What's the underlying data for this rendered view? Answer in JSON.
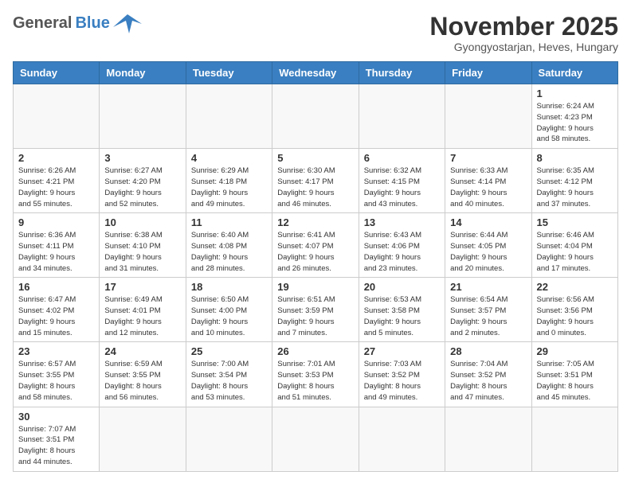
{
  "header": {
    "logo_general": "General",
    "logo_blue": "Blue",
    "month_title": "November 2025",
    "location": "Gyongyostarjan, Heves, Hungary"
  },
  "weekdays": [
    "Sunday",
    "Monday",
    "Tuesday",
    "Wednesday",
    "Thursday",
    "Friday",
    "Saturday"
  ],
  "weeks": [
    [
      {
        "day": "",
        "info": ""
      },
      {
        "day": "",
        "info": ""
      },
      {
        "day": "",
        "info": ""
      },
      {
        "day": "",
        "info": ""
      },
      {
        "day": "",
        "info": ""
      },
      {
        "day": "",
        "info": ""
      },
      {
        "day": "1",
        "info": "Sunrise: 6:24 AM\nSunset: 4:23 PM\nDaylight: 9 hours\nand 58 minutes."
      }
    ],
    [
      {
        "day": "2",
        "info": "Sunrise: 6:26 AM\nSunset: 4:21 PM\nDaylight: 9 hours\nand 55 minutes."
      },
      {
        "day": "3",
        "info": "Sunrise: 6:27 AM\nSunset: 4:20 PM\nDaylight: 9 hours\nand 52 minutes."
      },
      {
        "day": "4",
        "info": "Sunrise: 6:29 AM\nSunset: 4:18 PM\nDaylight: 9 hours\nand 49 minutes."
      },
      {
        "day": "5",
        "info": "Sunrise: 6:30 AM\nSunset: 4:17 PM\nDaylight: 9 hours\nand 46 minutes."
      },
      {
        "day": "6",
        "info": "Sunrise: 6:32 AM\nSunset: 4:15 PM\nDaylight: 9 hours\nand 43 minutes."
      },
      {
        "day": "7",
        "info": "Sunrise: 6:33 AM\nSunset: 4:14 PM\nDaylight: 9 hours\nand 40 minutes."
      },
      {
        "day": "8",
        "info": "Sunrise: 6:35 AM\nSunset: 4:12 PM\nDaylight: 9 hours\nand 37 minutes."
      }
    ],
    [
      {
        "day": "9",
        "info": "Sunrise: 6:36 AM\nSunset: 4:11 PM\nDaylight: 9 hours\nand 34 minutes."
      },
      {
        "day": "10",
        "info": "Sunrise: 6:38 AM\nSunset: 4:10 PM\nDaylight: 9 hours\nand 31 minutes."
      },
      {
        "day": "11",
        "info": "Sunrise: 6:40 AM\nSunset: 4:08 PM\nDaylight: 9 hours\nand 28 minutes."
      },
      {
        "day": "12",
        "info": "Sunrise: 6:41 AM\nSunset: 4:07 PM\nDaylight: 9 hours\nand 26 minutes."
      },
      {
        "day": "13",
        "info": "Sunrise: 6:43 AM\nSunset: 4:06 PM\nDaylight: 9 hours\nand 23 minutes."
      },
      {
        "day": "14",
        "info": "Sunrise: 6:44 AM\nSunset: 4:05 PM\nDaylight: 9 hours\nand 20 minutes."
      },
      {
        "day": "15",
        "info": "Sunrise: 6:46 AM\nSunset: 4:04 PM\nDaylight: 9 hours\nand 17 minutes."
      }
    ],
    [
      {
        "day": "16",
        "info": "Sunrise: 6:47 AM\nSunset: 4:02 PM\nDaylight: 9 hours\nand 15 minutes."
      },
      {
        "day": "17",
        "info": "Sunrise: 6:49 AM\nSunset: 4:01 PM\nDaylight: 9 hours\nand 12 minutes."
      },
      {
        "day": "18",
        "info": "Sunrise: 6:50 AM\nSunset: 4:00 PM\nDaylight: 9 hours\nand 10 minutes."
      },
      {
        "day": "19",
        "info": "Sunrise: 6:51 AM\nSunset: 3:59 PM\nDaylight: 9 hours\nand 7 minutes."
      },
      {
        "day": "20",
        "info": "Sunrise: 6:53 AM\nSunset: 3:58 PM\nDaylight: 9 hours\nand 5 minutes."
      },
      {
        "day": "21",
        "info": "Sunrise: 6:54 AM\nSunset: 3:57 PM\nDaylight: 9 hours\nand 2 minutes."
      },
      {
        "day": "22",
        "info": "Sunrise: 6:56 AM\nSunset: 3:56 PM\nDaylight: 9 hours\nand 0 minutes."
      }
    ],
    [
      {
        "day": "23",
        "info": "Sunrise: 6:57 AM\nSunset: 3:55 PM\nDaylight: 8 hours\nand 58 minutes."
      },
      {
        "day": "24",
        "info": "Sunrise: 6:59 AM\nSunset: 3:55 PM\nDaylight: 8 hours\nand 56 minutes."
      },
      {
        "day": "25",
        "info": "Sunrise: 7:00 AM\nSunset: 3:54 PM\nDaylight: 8 hours\nand 53 minutes."
      },
      {
        "day": "26",
        "info": "Sunrise: 7:01 AM\nSunset: 3:53 PM\nDaylight: 8 hours\nand 51 minutes."
      },
      {
        "day": "27",
        "info": "Sunrise: 7:03 AM\nSunset: 3:52 PM\nDaylight: 8 hours\nand 49 minutes."
      },
      {
        "day": "28",
        "info": "Sunrise: 7:04 AM\nSunset: 3:52 PM\nDaylight: 8 hours\nand 47 minutes."
      },
      {
        "day": "29",
        "info": "Sunrise: 7:05 AM\nSunset: 3:51 PM\nDaylight: 8 hours\nand 45 minutes."
      }
    ],
    [
      {
        "day": "30",
        "info": "Sunrise: 7:07 AM\nSunset: 3:51 PM\nDaylight: 8 hours\nand 44 minutes."
      },
      {
        "day": "",
        "info": ""
      },
      {
        "day": "",
        "info": ""
      },
      {
        "day": "",
        "info": ""
      },
      {
        "day": "",
        "info": ""
      },
      {
        "day": "",
        "info": ""
      },
      {
        "day": "",
        "info": ""
      }
    ]
  ]
}
